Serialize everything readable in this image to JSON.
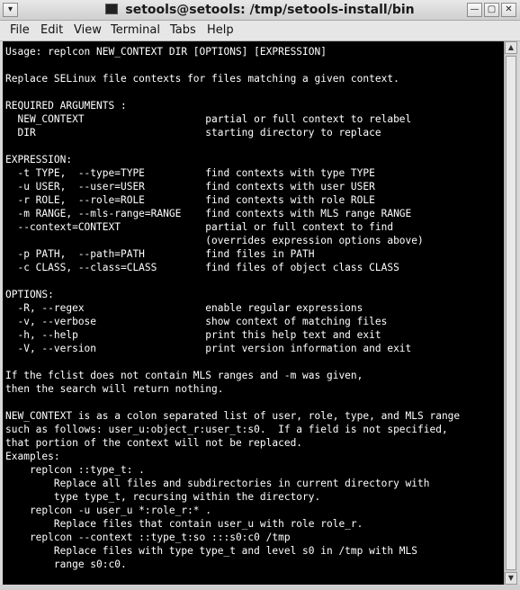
{
  "window": {
    "title": "setools@setools: /tmp/setools-install/bin",
    "minimize_glyph": "—",
    "maximize_glyph": "▢",
    "close_glyph": "✕"
  },
  "menu": [
    {
      "label": "File"
    },
    {
      "label": "Edit"
    },
    {
      "label": "View"
    },
    {
      "label": "Terminal"
    },
    {
      "label": "Tabs"
    },
    {
      "label": "Help"
    }
  ],
  "terminal": {
    "lines": [
      "Usage: replcon NEW_CONTEXT DIR [OPTIONS] [EXPRESSION]",
      "",
      "Replace SELinux file contexts for files matching a given context.",
      "",
      "REQUIRED ARGUMENTS :",
      "  NEW_CONTEXT                    partial or full context to relabel",
      "  DIR                            starting directory to replace",
      "",
      "EXPRESSION:",
      "  -t TYPE,  --type=TYPE          find contexts with type TYPE",
      "  -u USER,  --user=USER          find contexts with user USER",
      "  -r ROLE,  --role=ROLE          find contexts with role ROLE",
      "  -m RANGE, --mls-range=RANGE    find contexts with MLS range RANGE",
      "  --context=CONTEXT              partial or full context to find",
      "                                 (overrides expression options above)",
      "  -p PATH,  --path=PATH          find files in PATH",
      "  -c CLASS, --class=CLASS        find files of object class CLASS",
      "",
      "OPTIONS:",
      "  -R, --regex                    enable regular expressions",
      "  -v, --verbose                  show context of matching files",
      "  -h, --help                     print this help text and exit",
      "  -V, --version                  print version information and exit",
      "",
      "If the fclist does not contain MLS ranges and -m was given,",
      "then the search will return nothing.",
      "",
      "NEW_CONTEXT is as a colon separated list of user, role, type, and MLS range",
      "such as follows: user_u:object_r:user_t:s0.  If a field is not specified,",
      "that portion of the context will not be replaced.",
      "Examples:",
      "    replcon ::type_t: .",
      "        Replace all files and subdirectories in current directory with",
      "        type type_t, recursing within the directory.",
      "    replcon -u user_u *:role_r:* .",
      "        Replace files that contain user_u with role role_r.",
      "    replcon --context ::type_t:so :::s0:c0 /tmp",
      "        Replace files with type type_t and level s0 in /tmp with MLS",
      "        range s0:c0.",
      ""
    ]
  }
}
